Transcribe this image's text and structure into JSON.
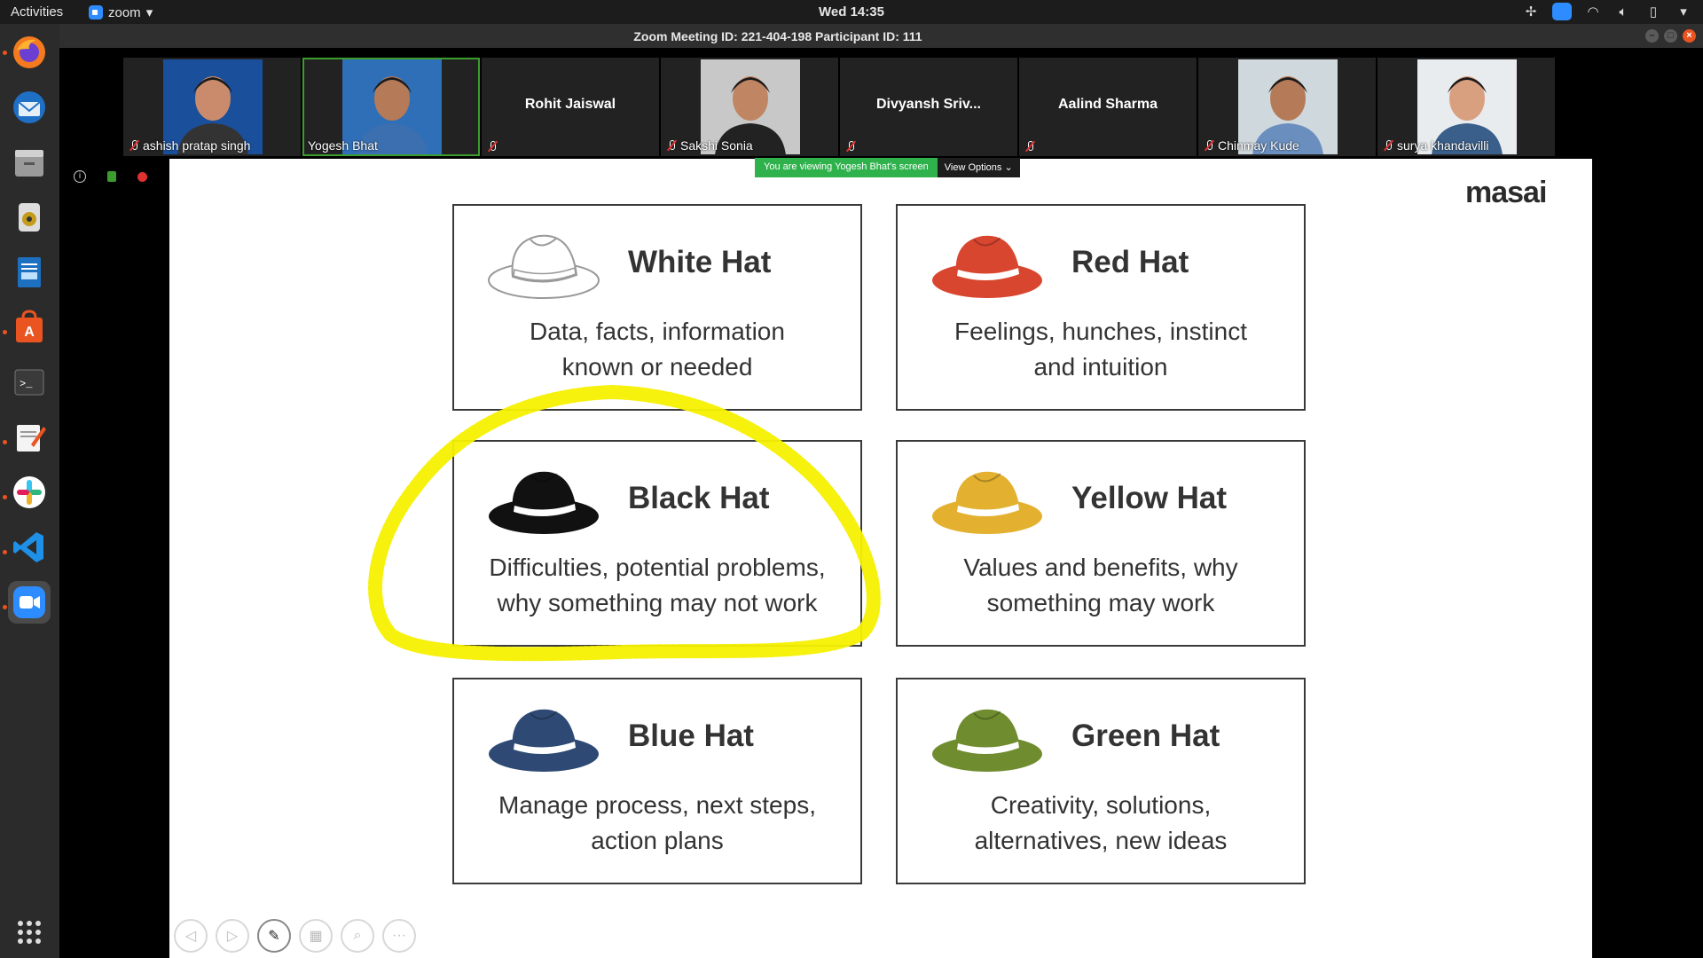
{
  "topbar": {
    "activities": "Activities",
    "app_name": "zoom",
    "clock": "Wed 14:35"
  },
  "window": {
    "title": "Zoom Meeting ID: 221-404-198 Participant ID: 111"
  },
  "participants": [
    {
      "name": "ashish pratap singh",
      "has_video": true,
      "muted": true,
      "active": false
    },
    {
      "name": "Yogesh Bhat",
      "has_video": true,
      "muted": false,
      "active": true
    },
    {
      "name": "Rohit Jaiswal",
      "has_video": false,
      "muted": true,
      "active": false
    },
    {
      "name": "Sakshi Sonia",
      "has_video": true,
      "muted": true,
      "active": false
    },
    {
      "name": "Divyansh Sriv...",
      "has_video": false,
      "muted": true,
      "active": false
    },
    {
      "name": "Aalind Sharma",
      "has_video": false,
      "muted": true,
      "active": false
    },
    {
      "name": "Chinmay Kude",
      "has_video": true,
      "muted": true,
      "active": false
    },
    {
      "name": "surya khandavilli",
      "has_video": true,
      "muted": true,
      "active": false
    }
  ],
  "share_banner": {
    "message": "You are viewing Yogesh Bhat's screen",
    "options_label": "View Options"
  },
  "slide": {
    "logo": "masai",
    "hats": [
      {
        "title": "White Hat",
        "line1": "Data, facts, information",
        "line2": "known or needed",
        "color": "#ffffff"
      },
      {
        "title": "Red Hat",
        "line1": "Feelings, hunches, instinct",
        "line2": "and intuition",
        "color": "#d9462f"
      },
      {
        "title": "Black Hat",
        "line1": "Difficulties, potential problems,",
        "line2": "why something may not work",
        "color": "#111111"
      },
      {
        "title": "Yellow Hat",
        "line1": "Values and benefits, why",
        "line2": "something may work",
        "color": "#e3b12f"
      },
      {
        "title": "Blue Hat",
        "line1": "Manage process, next steps,",
        "line2": "action plans",
        "color": "#2e4a74"
      },
      {
        "title": "Green Hat",
        "line1": "Creativity, solutions,",
        "line2": "alternatives, new ideas",
        "color": "#6f8c2f"
      }
    ]
  },
  "colors": {
    "annotation": "#f5f000",
    "share_green": "#2fb24c",
    "active_border": "#3c9d2e"
  }
}
